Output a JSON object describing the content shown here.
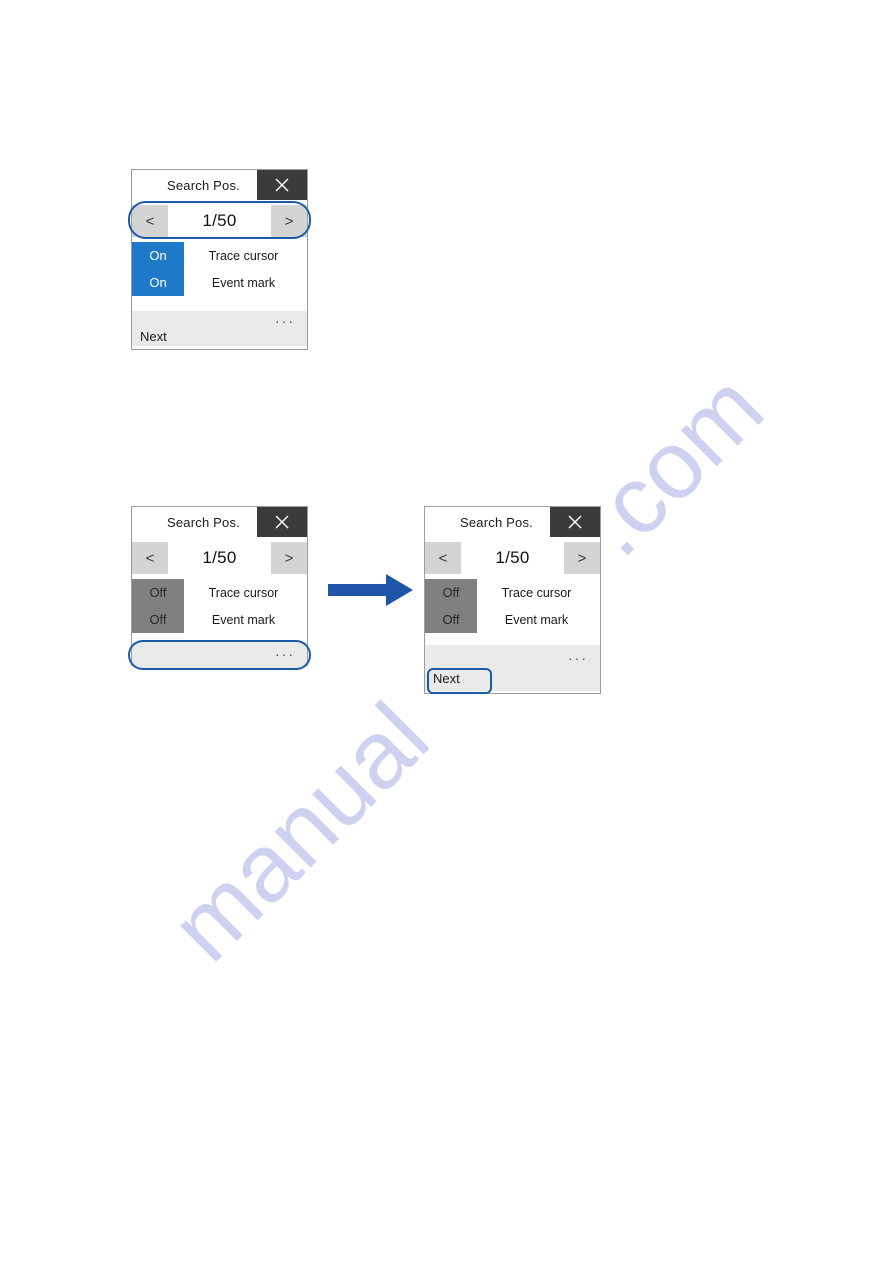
{
  "watermark": {
    "line_top": ".com",
    "line_bottom": "manual"
  },
  "panels": [
    {
      "id": "panel-on-state",
      "titlebar": {
        "title": "Search Pos.",
        "close_icon": "close-icon"
      },
      "nav": {
        "prev_label": "<",
        "next_label": ">",
        "value": "1/50"
      },
      "options": [
        {
          "state": "On",
          "label": "Trace cursor"
        },
        {
          "state": "On",
          "label": "Event mark"
        }
      ],
      "footer": {
        "dots": "···",
        "next_label": "Next"
      },
      "highlight": "nav-row"
    },
    {
      "id": "panel-off-before",
      "titlebar": {
        "title": "Search Pos.",
        "close_icon": "close-icon"
      },
      "nav": {
        "prev_label": "<",
        "next_label": ">",
        "value": "1/50"
      },
      "options": [
        {
          "state": "Off",
          "label": "Trace cursor"
        },
        {
          "state": "Off",
          "label": "Event mark"
        }
      ],
      "footer": {
        "dots": "···",
        "next_label": ""
      },
      "highlight": "footer-bar"
    },
    {
      "id": "panel-off-after",
      "titlebar": {
        "title": "Search Pos.",
        "close_icon": "close-icon"
      },
      "nav": {
        "prev_label": "<",
        "next_label": ">",
        "value": "1/50"
      },
      "options": [
        {
          "state": "Off",
          "label": "Trace cursor"
        },
        {
          "state": "Off",
          "label": "Event mark"
        }
      ],
      "footer": {
        "dots": "···",
        "next_label": "Next"
      },
      "highlight": "next-button"
    }
  ],
  "arrow": {
    "name": "flow-arrow-right",
    "color": "#1f55a8"
  },
  "colors": {
    "accent_blue": "#1e7ac8",
    "state_off_gray": "#808080",
    "highlight_blue": "#1f5aa8",
    "titlebar_close": "#3b3b3b",
    "footer_gray": "#e9e9e9",
    "navbtn_gray": "#d4d4d4",
    "watermark": "#c7c9ee"
  }
}
